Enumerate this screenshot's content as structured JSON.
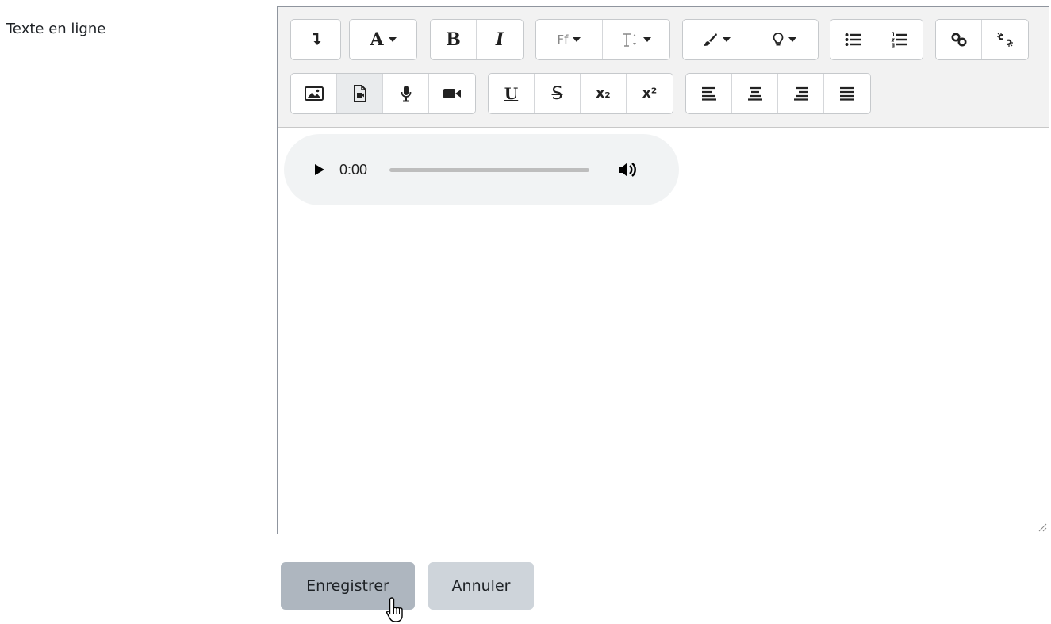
{
  "form": {
    "field_label": "Texte en ligne"
  },
  "toolbar": {
    "row1": [
      {
        "name": "show-more-icon"
      },
      {
        "name": "font-color-icon",
        "label": "A"
      },
      {
        "name": "bold-icon",
        "label": "B"
      },
      {
        "name": "italic-icon",
        "label": "I"
      },
      {
        "name": "font-family-icon",
        "label": "Ff"
      },
      {
        "name": "font-size-icon",
        "label": "T"
      },
      {
        "name": "background-color-icon"
      },
      {
        "name": "styles-icon"
      },
      {
        "name": "unordered-list-icon"
      },
      {
        "name": "ordered-list-icon"
      },
      {
        "name": "link-icon"
      },
      {
        "name": "unlink-icon"
      }
    ],
    "row2": [
      {
        "name": "image-icon"
      },
      {
        "name": "media-icon"
      },
      {
        "name": "record-audio-icon"
      },
      {
        "name": "record-video-icon"
      },
      {
        "name": "underline-icon",
        "label": "U"
      },
      {
        "name": "strikethrough-icon",
        "label": "S"
      },
      {
        "name": "subscript-icon",
        "label": "x₂"
      },
      {
        "name": "superscript-icon",
        "label": "x²"
      },
      {
        "name": "align-left-icon"
      },
      {
        "name": "align-center-icon"
      },
      {
        "name": "align-right-icon"
      },
      {
        "name": "align-justify-icon"
      }
    ]
  },
  "player": {
    "time": "0:00",
    "progress": 0
  },
  "actions": {
    "save_label": "Enregistrer",
    "cancel_label": "Annuler"
  },
  "colors": {
    "primary_button": "#aeb6bf",
    "secondary_button": "#ced4da",
    "toolbar_bg": "#f2f2f2"
  }
}
